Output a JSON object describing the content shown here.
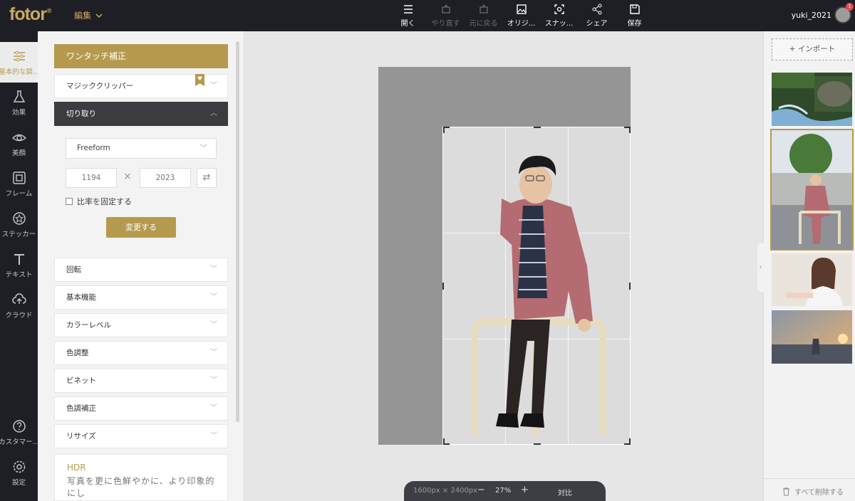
{
  "header": {
    "logo": "fotor",
    "logo_mark": "®",
    "edit_menu": "編集",
    "tools": [
      {
        "label": "開く",
        "icon": "menu-icon",
        "enabled": true
      },
      {
        "label": "やり直す",
        "icon": "redo-icon",
        "enabled": false
      },
      {
        "label": "元に戻る",
        "icon": "undo-icon",
        "enabled": false
      },
      {
        "label": "オリジ...",
        "icon": "image-icon",
        "enabled": true
      },
      {
        "label": "スナッ...",
        "icon": "snapshot-icon",
        "enabled": true
      },
      {
        "label": "シェア",
        "icon": "share-icon",
        "enabled": true
      },
      {
        "label": "保存",
        "icon": "save-icon",
        "enabled": true
      }
    ],
    "username": "yuki_2021",
    "notification_count": "1"
  },
  "leftnav": [
    {
      "label": "基本的な調...",
      "icon": "sliders-icon",
      "active": true
    },
    {
      "label": "効果",
      "icon": "flask-icon",
      "active": false
    },
    {
      "label": "美顔",
      "icon": "eye-icon",
      "active": false
    },
    {
      "label": "フレーム",
      "icon": "frame-icon",
      "active": false
    },
    {
      "label": "ステッカー",
      "icon": "sticker-icon",
      "active": false
    },
    {
      "label": "テキスト",
      "icon": "text-icon",
      "active": false
    },
    {
      "label": "クラウド",
      "icon": "cloud-icon",
      "active": false
    },
    {
      "label": "カスタマー...",
      "icon": "help-icon",
      "active": false
    },
    {
      "label": "設定",
      "icon": "settings-icon",
      "active": false
    }
  ],
  "panel": {
    "one_touch": "ワンタッチ補正",
    "magic_clipper": "マジッククリッパー",
    "crop": "切り取り",
    "crop_mode": "Freeform",
    "width": "1194",
    "height": "2023",
    "times": "×",
    "lock_ratio": "比率を固定する",
    "apply": "変更する",
    "sections": [
      "回転",
      "基本機能",
      "カラーレベル",
      "色調整",
      "ビネット",
      "色調補正",
      "リサイズ"
    ],
    "hdr_title": "HDR",
    "hdr_desc": "写真を更に色鮮やかに、より印象的にし"
  },
  "zoom": {
    "dimensions": "1600px × 2400px",
    "minus": "−",
    "level": "27%",
    "plus": "+",
    "compare": "対比"
  },
  "rightpanel": {
    "import": "インポート",
    "delete_all": "すべて削除する"
  },
  "colors": {
    "accent": "#b59a4e",
    "dark": "#1e1f24"
  }
}
